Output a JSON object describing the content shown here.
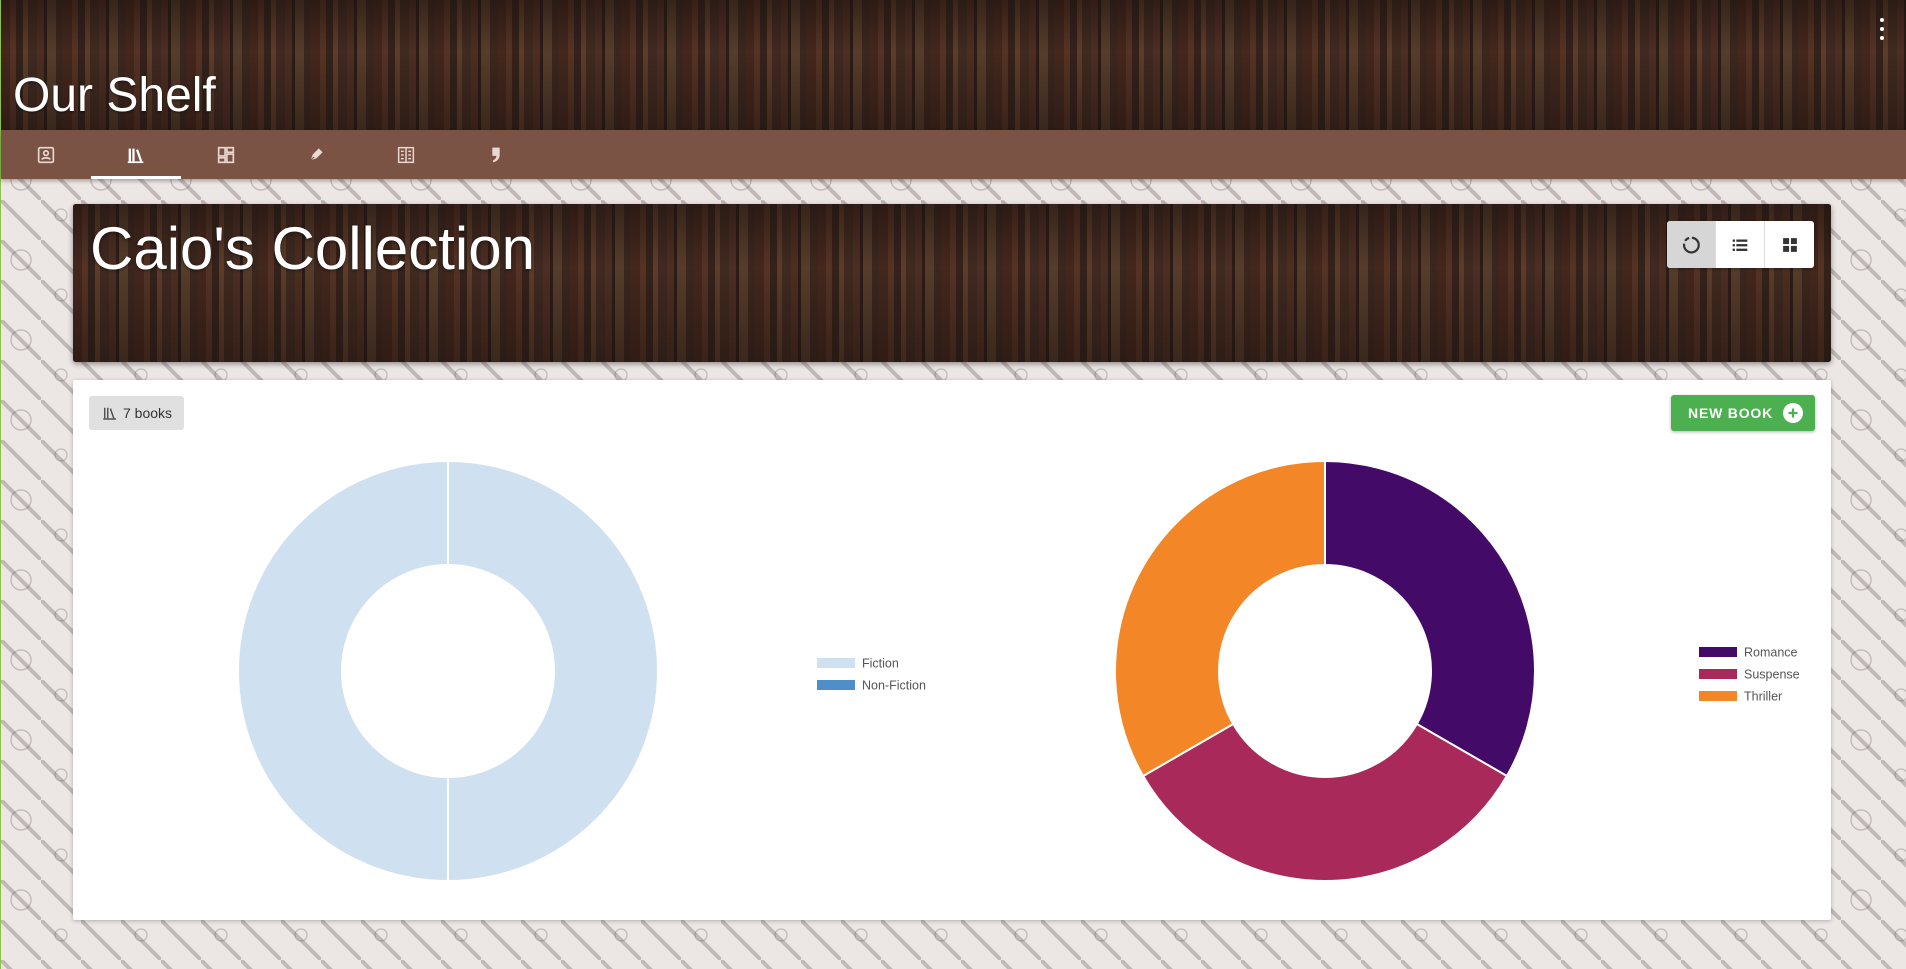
{
  "app": {
    "title": "Our Shelf"
  },
  "tabs": [
    {
      "icon": "contact-card-icon",
      "active": false
    },
    {
      "icon": "library-books-icon",
      "active": true
    },
    {
      "icon": "dashboard-icon",
      "active": false
    },
    {
      "icon": "pen-nib-icon",
      "active": false
    },
    {
      "icon": "building-icon",
      "active": false
    },
    {
      "icon": "quote-icon",
      "active": false
    }
  ],
  "collection": {
    "title": "Caio's Collection",
    "view_modes": [
      {
        "icon": "donut-chart-icon",
        "active": true
      },
      {
        "icon": "list-icon",
        "active": false
      },
      {
        "icon": "grid-icon",
        "active": false
      }
    ]
  },
  "toolbar": {
    "count_label": "7 books",
    "new_book_label": "NEW BOOK"
  },
  "colors": {
    "header_tab_bar": "#7a5345",
    "new_book_button": "#4caf50",
    "fiction": "#cfe0f0",
    "non_fiction": "#4f8ec9",
    "romance": "#440a67",
    "suspense": "#a8295a",
    "thriller": "#f38626"
  },
  "chart_data": [
    {
      "type": "pie",
      "donut": true,
      "categories": [
        "Fiction",
        "Non-Fiction"
      ],
      "values": [
        7,
        0
      ],
      "colors": [
        "#cfe0f0",
        "#4f8ec9"
      ],
      "legend_position": "right"
    },
    {
      "type": "pie",
      "donut": true,
      "categories": [
        "Romance",
        "Suspense",
        "Thriller"
      ],
      "values": [
        1,
        1,
        1
      ],
      "colors": [
        "#440a67",
        "#a8295a",
        "#f38626"
      ],
      "legend_position": "right"
    }
  ]
}
